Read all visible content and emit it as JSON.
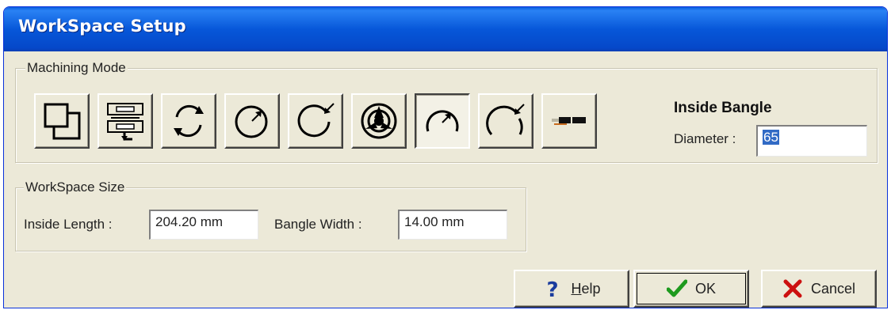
{
  "window": {
    "title": "WorkSpace Setup"
  },
  "machining_mode": {
    "label": "Machining Mode",
    "buttons": [
      {
        "icon": "flat-workspace-icon"
      },
      {
        "icon": "flat-clamp-icon"
      },
      {
        "icon": "rotary-ring-icon"
      },
      {
        "icon": "outside-ring-icon"
      },
      {
        "icon": "inside-ring-icon"
      },
      {
        "icon": "three-jaw-chuck-icon"
      },
      {
        "icon": "outside-bangle-icon",
        "selected": true
      },
      {
        "icon": "inside-bangle-icon"
      },
      {
        "icon": "pendant-bar-icon"
      }
    ],
    "mode_title": "Inside Bangle",
    "diameter_label": "Diameter :",
    "diameter_value": "65"
  },
  "workspace_size": {
    "label": "WorkSpace Size",
    "inside_length_label": "Inside Length :",
    "inside_length_value": "204.20 mm",
    "bangle_width_label": "Bangle Width :",
    "bangle_width_value": "14.00 mm"
  },
  "actions": {
    "help_prefix": "",
    "help_mnemonic": "H",
    "help_rest": "elp",
    "ok": "OK",
    "cancel": "Cancel"
  },
  "colors": {
    "titlebar": "#0757d9",
    "dialog_bg": "#ece9d8",
    "selection": "#316ac5",
    "ok_check": "#1e9a1e",
    "cancel_x": "#cc1010",
    "help_icon": "#1a3c9e"
  }
}
